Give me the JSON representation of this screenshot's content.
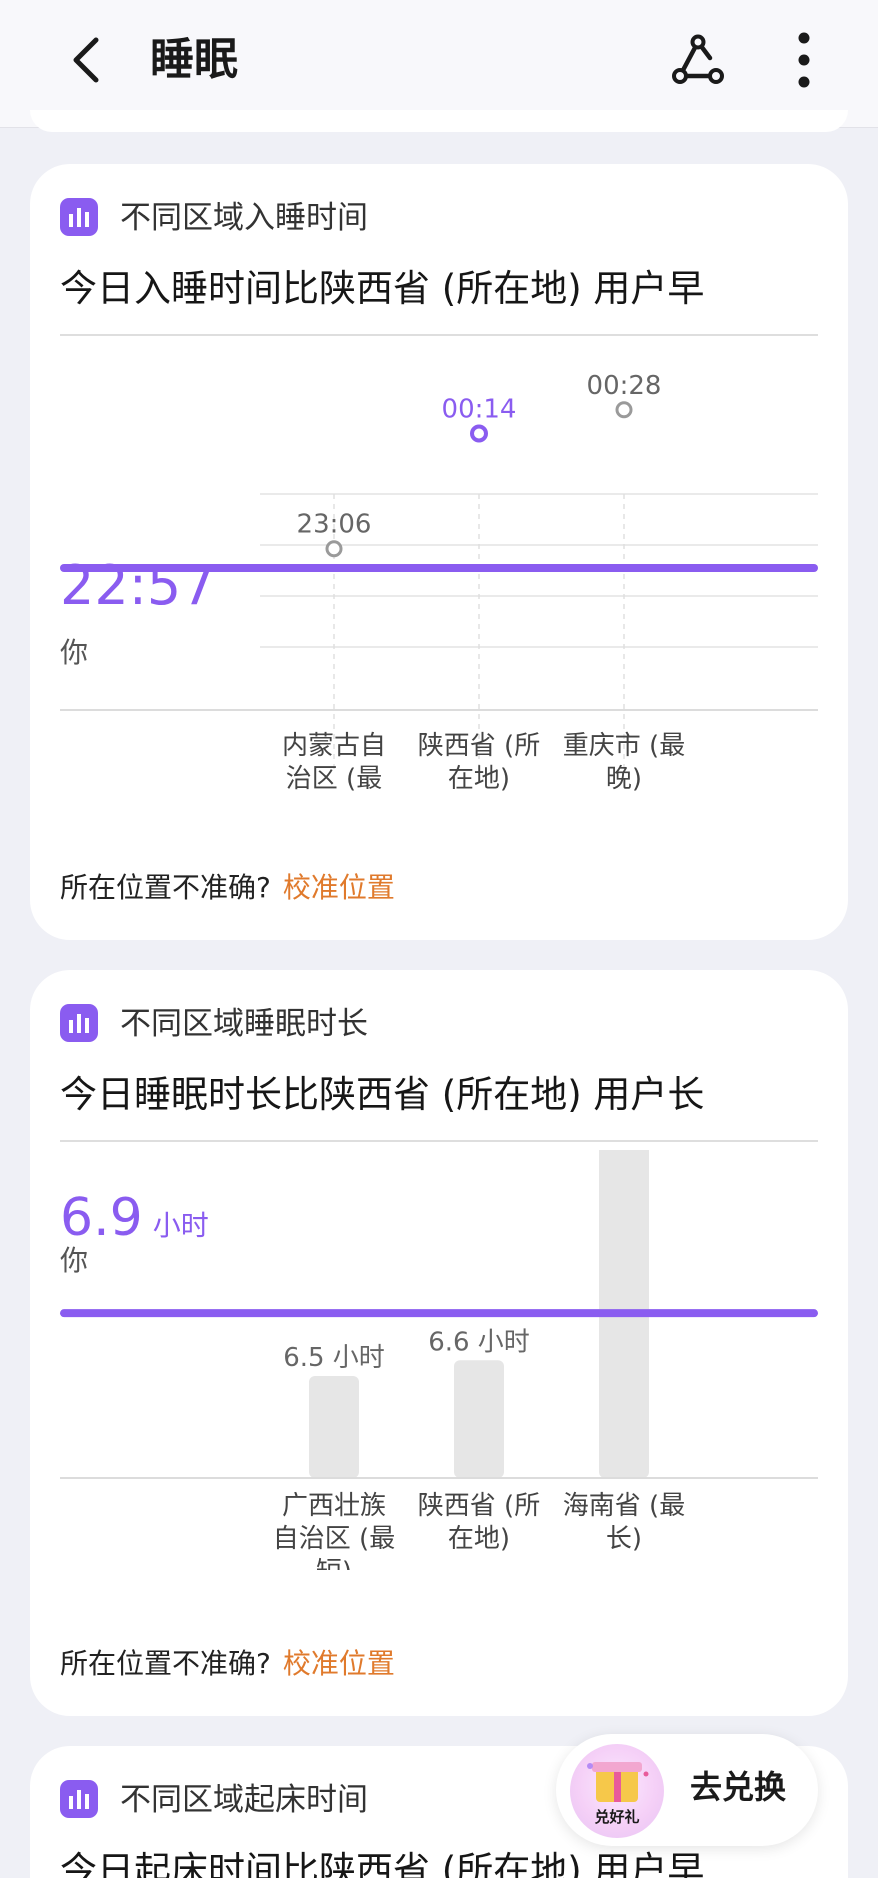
{
  "appbar": {
    "title": "睡眠"
  },
  "card1": {
    "category": "不同区域入睡时间",
    "headline": "今日入睡时间比陕西省 (所在地) 用户早",
    "footer_question": "所在位置不准确?",
    "footer_link": "校准位置"
  },
  "card2": {
    "category": "不同区域睡眠时长",
    "headline": "今日睡眠时长比陕西省 (所在地) 用户长",
    "footer_question": "所在位置不准确?",
    "footer_link": "校准位置"
  },
  "card3": {
    "category": "不同区域起床时间",
    "headline": "今日起床时间比陕西省 (所在地) 用户早"
  },
  "redeem": {
    "label": "去兑换",
    "badge_text": "兑好礼"
  },
  "colors": {
    "accent": "#8a5cf0",
    "link": "#e07a2c",
    "bar": "#e6e6e6",
    "point": "#9a9a9a"
  },
  "chart_data": [
    {
      "type": "scatter",
      "you": {
        "label": "你",
        "value": "22:57"
      },
      "points": [
        {
          "category": [
            "内蒙古自",
            "治区 (最",
            "早)"
          ],
          "value": "23:06",
          "highlight": false
        },
        {
          "category": [
            "陕西省 (所",
            "在地)"
          ],
          "value": "00:14",
          "highlight": true
        },
        {
          "category": [
            "重庆市 (最",
            "晚)"
          ],
          "value": "00:28",
          "highlight": false
        }
      ]
    },
    {
      "type": "bar",
      "you": {
        "label": "你",
        "value": 6.9,
        "unit": "小时"
      },
      "unit": "小时",
      "bars": [
        {
          "category": [
            "广西壮族",
            "自治区 (最",
            "短)"
          ],
          "value": 6.5
        },
        {
          "category": [
            "陕西省 (所",
            "在地)"
          ],
          "value": 6.6
        },
        {
          "category": [
            "海南省 (最",
            "长)"
          ],
          "value": 8.1
        }
      ]
    }
  ]
}
